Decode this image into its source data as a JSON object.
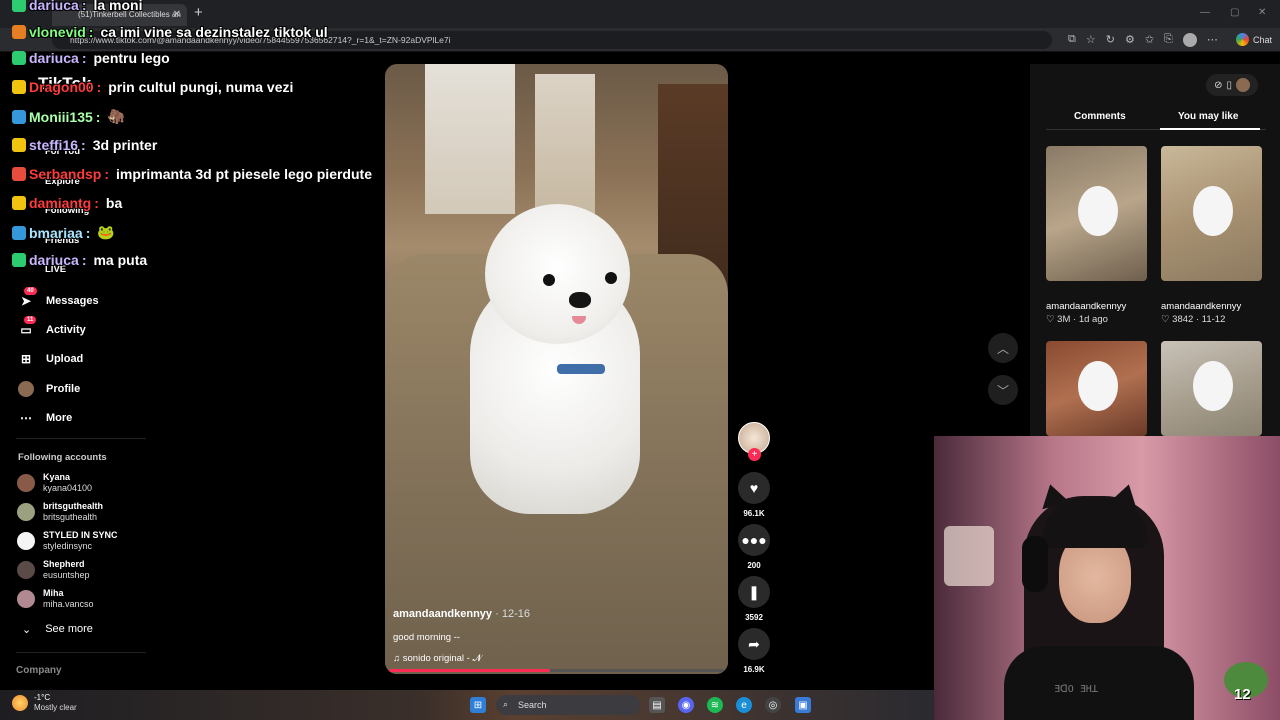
{
  "browser": {
    "tab_title": "(51)Tinkerbell Collectibles an",
    "url": "https://www.tiktok.com/@amandaandkennyy/video/758445597536562714?_r=1&_t=ZN-92aDVPlLe7i",
    "chat_label": "Chat"
  },
  "sidebar": {
    "logo": "TikTok",
    "nav": [
      {
        "label": "For You",
        "icon": "home-icon"
      },
      {
        "label": "Explore",
        "icon": "compass-icon"
      },
      {
        "label": "Following",
        "icon": "users-icon"
      },
      {
        "label": "Friends",
        "icon": "friends-icon"
      },
      {
        "label": "LIVE",
        "icon": "live-icon"
      },
      {
        "label": "Messages",
        "icon": "send-icon",
        "badge": "40"
      },
      {
        "label": "Activity",
        "icon": "inbox-icon",
        "badge": "11"
      },
      {
        "label": "Upload",
        "icon": "plus-square-icon"
      },
      {
        "label": "Profile",
        "icon": "avatar"
      },
      {
        "label": "More",
        "icon": "ellipsis-icon"
      }
    ],
    "following_title": "Following accounts",
    "following": [
      {
        "name": "Kyana",
        "handle": "kyana04100"
      },
      {
        "name": "britsguthealth",
        "handle": "britsguthealth"
      },
      {
        "name": "STYLED IN SYNC",
        "handle": "styledinsync"
      },
      {
        "name": "Shepherd",
        "handle": "eusuntshep"
      },
      {
        "name": "Miha",
        "handle": "miha.vancso"
      }
    ],
    "see_more": "See more",
    "company": "Company"
  },
  "video": {
    "author": "amandaandkennyy",
    "date": "· 12-16",
    "caption": "good morning --",
    "music": "sonido original - 𝓝",
    "progress_percent": 48
  },
  "actions": {
    "likes": "96.1K",
    "comments": "200",
    "saves": "3592",
    "shares": "16.9K"
  },
  "right_panel": {
    "tab_comments": "Comments",
    "tab_you_may_like": "You may like",
    "items": [
      {
        "author": "amandaandkennyy",
        "likes": "3M",
        "time": "1d ago"
      },
      {
        "author": "amandaandkennyy",
        "likes": "3842",
        "time": "11-12"
      }
    ]
  },
  "chat": [
    {
      "user": "dariuca",
      "color": "#c9b6ff",
      "msg": "la moni"
    },
    {
      "user": "vlonevid",
      "color": "#7fff7f",
      "msg": "ca imi vine sa dezinstalez tiktok ul"
    },
    {
      "user": "dariuca",
      "color": "#c9b6ff",
      "msg": "pentru lego"
    },
    {
      "user": "Dragon00",
      "color": "#ff3b3b",
      "msg": "prin cultul pungi, numa vezi"
    },
    {
      "user": "Moniii135",
      "color": "#aaffaa",
      "msg": "🦣"
    },
    {
      "user": "steffi16",
      "color": "#c9b6ff",
      "msg": "3d printer"
    },
    {
      "user": "Serbandsp",
      "color": "#ff3b3b",
      "msg": "imprimanta 3d pt piesele lego pierdute"
    },
    {
      "user": "damiantg",
      "color": "#ff3b3b",
      "msg": "ba"
    },
    {
      "user": "bmariaa",
      "color": "#a8e6ff",
      "msg": "🐸"
    },
    {
      "user": "dariuca",
      "color": "#c9b6ff",
      "msg": "ma puta"
    }
  ],
  "webcam": {
    "shirt_text": "ƎᗡO ƎHꓕ",
    "frog_count": "12"
  },
  "taskbar": {
    "temp": "-1°C",
    "weather": "Mostly clear",
    "search": "Search"
  },
  "colors": {
    "accent": "#fe2c55",
    "background": "#000000"
  }
}
